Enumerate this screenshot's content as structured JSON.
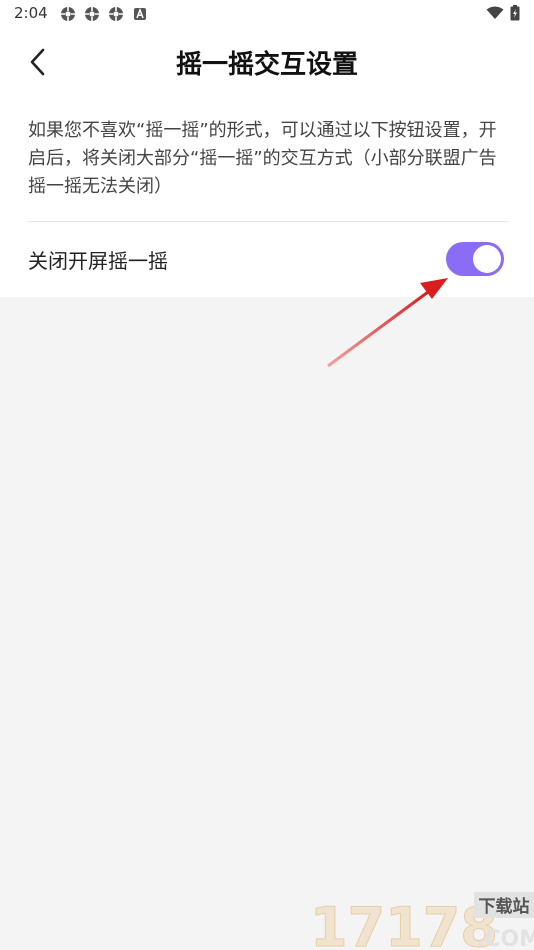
{
  "status_bar": {
    "time": "2:04",
    "left_icons": [
      "settings-gear-icon",
      "settings-gear-icon",
      "settings-gear-icon",
      "a-notification-icon"
    ],
    "right_icons": [
      "wifi-icon",
      "battery-icon"
    ]
  },
  "header": {
    "title": "摇一摇交互设置",
    "back_icon": "chevron-left-icon"
  },
  "description": "如果您不喜欢“摇一摇”的形式，可以通过以下按钮设置，开启后，将关闭大部分“摇一摇”的交互方式（小部分联盟广告摇一摇无法关闭）",
  "settings": {
    "toggle_label": "关闭开屏摇一摇",
    "toggle_on": true
  },
  "watermark": {
    "number": "17178",
    "site_name": "下载站",
    "domain": ".COM"
  },
  "colors": {
    "accent": "#8a6cf5",
    "arrow": "#d81e1e",
    "background": "#f4f4f4"
  }
}
